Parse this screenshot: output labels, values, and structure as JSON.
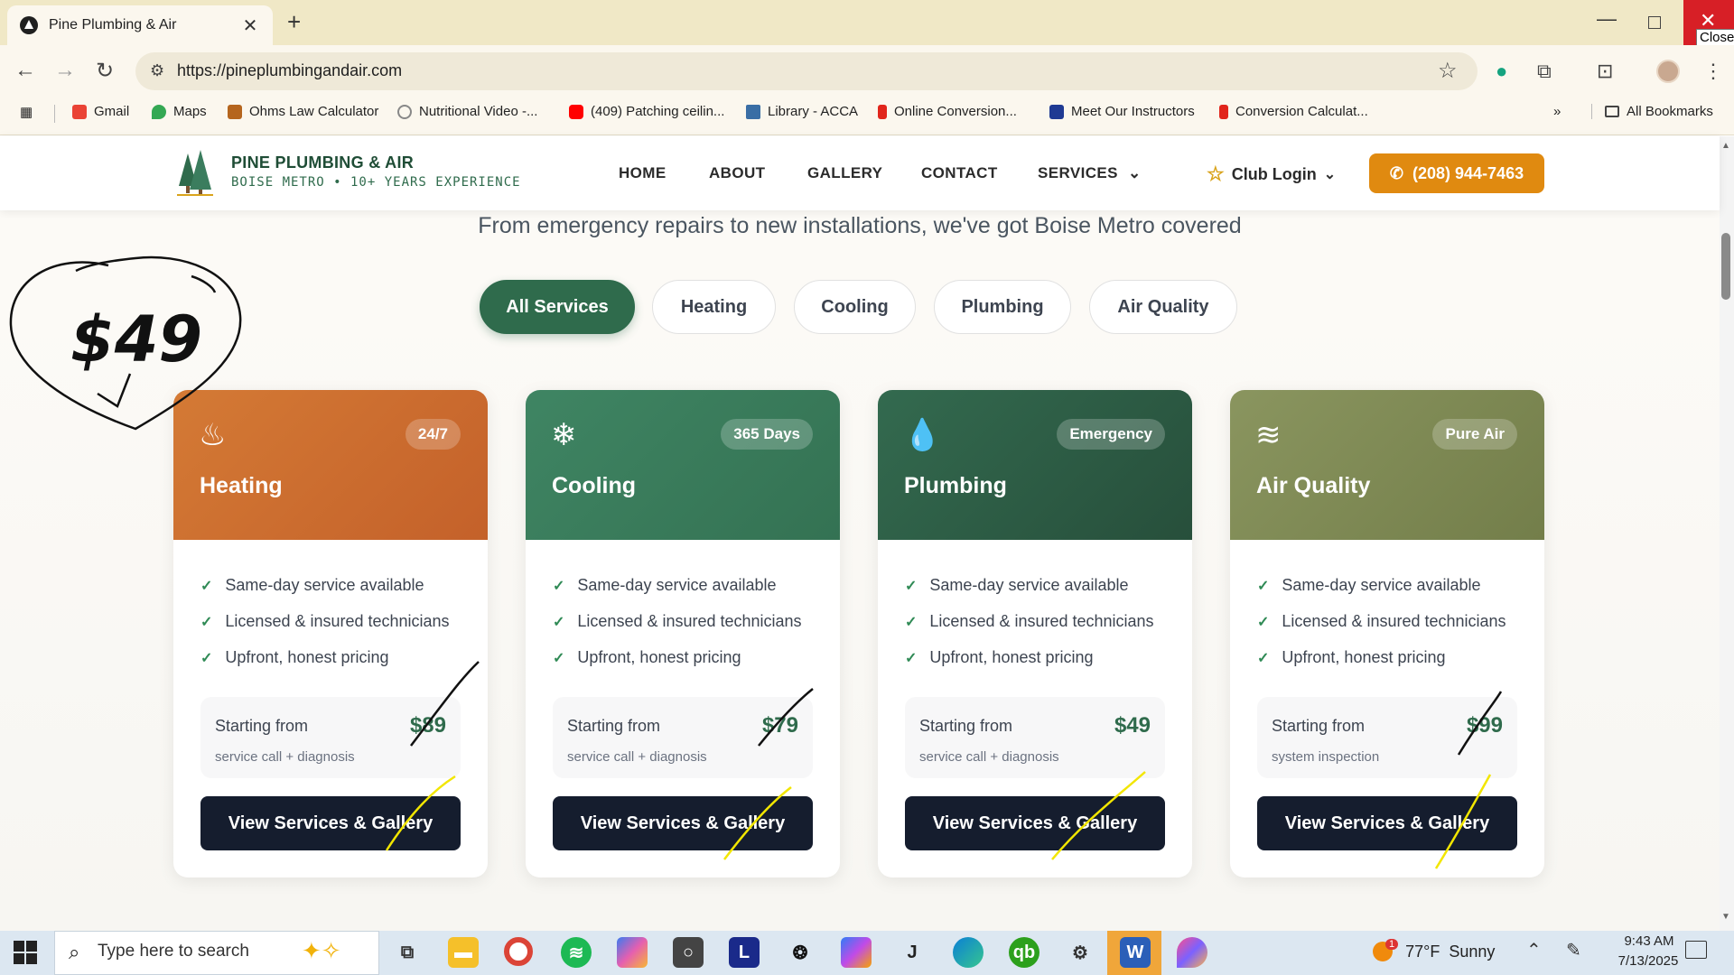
{
  "browser": {
    "tab_title": "Pine Plumbing & Air",
    "url": "https://pineplumbingandair.com",
    "close_tooltip": "Close",
    "bookmarks": [
      {
        "label": "Gmail",
        "color": "#ea4335"
      },
      {
        "label": "Maps",
        "color": "#34a853"
      },
      {
        "label": "Ohms Law Calculator",
        "color": "#b5651d"
      },
      {
        "label": "Nutritional Video -...",
        "color": "#888888"
      },
      {
        "label": "(409) Patching ceilin...",
        "color": "#ff0000"
      },
      {
        "label": "Library - ACCA",
        "color": "#3a6ea5"
      },
      {
        "label": "Online Conversion...",
        "color": "#e1251b"
      },
      {
        "label": "Meet Our Instructors",
        "color": "#1f3a93"
      },
      {
        "label": "Conversion Calculat...",
        "color": "#e1251b"
      }
    ],
    "all_bookmarks": "All Bookmarks"
  },
  "site": {
    "brand_name": "PINE PLUMBING & AIR",
    "brand_tagline": "BOISE METRO • 10+ YEARS EXPERIENCE",
    "nav": [
      "HOME",
      "ABOUT",
      "GALLERY",
      "CONTACT",
      "SERVICES"
    ],
    "club_login": "Club Login",
    "phone": "(208) 944-7463",
    "subtitle": "From emergency repairs to new installations, we've got Boise Metro covered",
    "filters": [
      "All Services",
      "Heating",
      "Cooling",
      "Plumbing",
      "Air Quality"
    ],
    "active_filter": "All Services",
    "cards": [
      {
        "title": "Heating",
        "badge": "24/7",
        "icon": "flame-icon",
        "color": "#cc6a2c",
        "features": [
          "Same-day service available",
          "Licensed & insured technicians",
          "Upfront, honest pricing"
        ],
        "price_label": "Starting from",
        "price": "$89",
        "price_note": "service call + diagnosis",
        "button": "View Services & Gallery"
      },
      {
        "title": "Cooling",
        "badge": "365 Days",
        "icon": "snowflake-icon",
        "color": "#3b7d5e",
        "features": [
          "Same-day service available",
          "Licensed & insured technicians",
          "Upfront, honest pricing"
        ],
        "price_label": "Starting from",
        "price": "$79",
        "price_note": "service call + diagnosis",
        "button": "View Services & Gallery"
      },
      {
        "title": "Plumbing",
        "badge": "Emergency",
        "icon": "droplets-icon",
        "color": "#2e5f47",
        "features": [
          "Same-day service available",
          "Licensed & insured technicians",
          "Upfront, honest pricing"
        ],
        "price_label": "Starting from",
        "price": "$49",
        "price_note": "service call + diagnosis",
        "button": "View Services & Gallery"
      },
      {
        "title": "Air Quality",
        "badge": "Pure Air",
        "icon": "wind-icon",
        "color": "#7f8a55",
        "features": [
          "Same-day service available",
          "Licensed & insured technicians",
          "Upfront, honest pricing"
        ],
        "price_label": "Starting from",
        "price": "$99",
        "price_note": "system inspection",
        "button": "View Services & Gallery"
      }
    ]
  },
  "annotation": {
    "handwritten_price": "$49"
  },
  "taskbar": {
    "search_placeholder": "Type here to search",
    "weather": "77°F  Sunny",
    "weather_badge": "1",
    "time": "9:43 AM",
    "date": "7/13/2025"
  }
}
